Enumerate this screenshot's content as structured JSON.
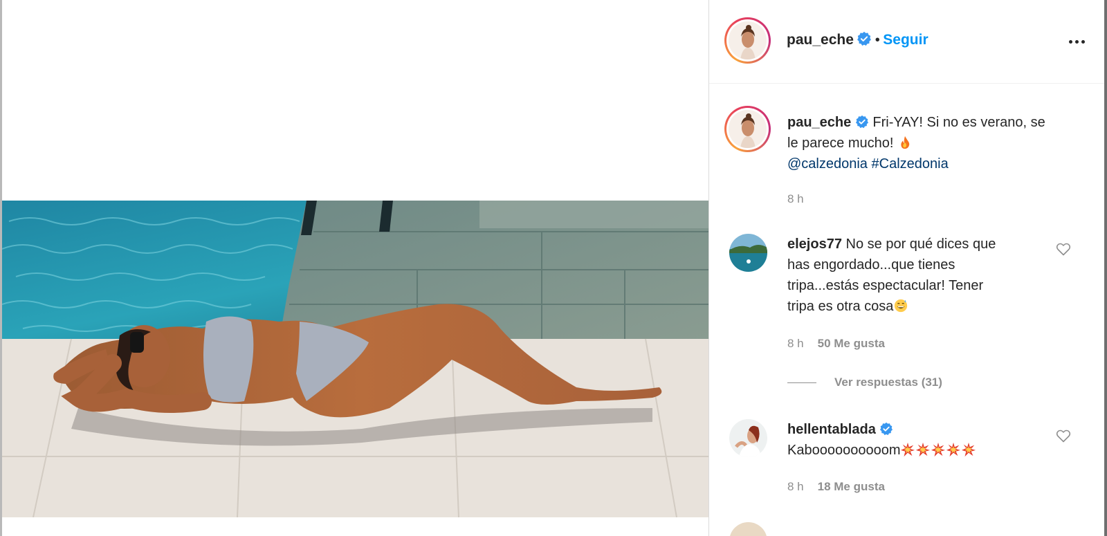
{
  "post": {
    "username": "pau_eche",
    "separator": "•",
    "follow_label": "Seguir",
    "caption_line1": "Fri-YAY! Si no es verano, se",
    "caption_line2": "le parece mucho!",
    "mention": "@calzedonia",
    "hashtag": "#Calzedonia",
    "caption_time": "8 h"
  },
  "comments": [
    {
      "username": "elejos77",
      "text_line1": "No se por qué dices que",
      "text_line2": "has engordado...que tienes",
      "text_line3": "tripa...estás espectacular! Tener",
      "text_line4": "tripa es otra cosa",
      "time": "8 h",
      "likes": "50 Me gusta",
      "replies": "Ver respuestas (31)"
    },
    {
      "username": "hellentablada",
      "text": "Kaboooooooooom",
      "time": "8 h",
      "likes": "18 Me gusta"
    }
  ],
  "icons": {
    "verified": "verified-badge-icon",
    "more": "more-options-icon",
    "heart": "heart-outline-icon",
    "fire": "fire-emoji",
    "sweat_smile": "grinning-sweat-emoji",
    "collision": "collision-emoji"
  },
  "colors": {
    "accent": "#0095f6",
    "link": "#00376b",
    "verified": "#3897f0",
    "muted": "#8e8e8e"
  }
}
